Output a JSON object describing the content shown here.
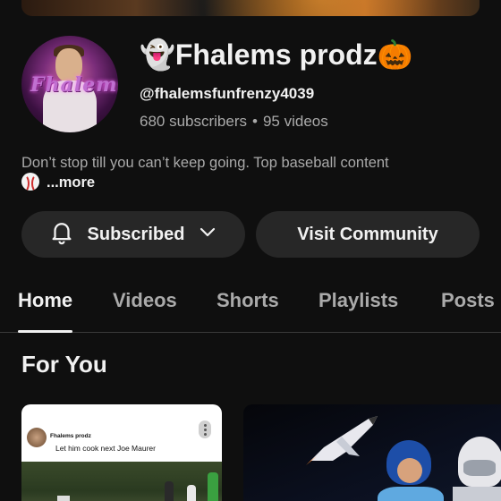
{
  "channel": {
    "name": "👻Fhalems prodz🎃",
    "handle": "@fhalemsfunfrenzy4039",
    "subscribers": "680 subscribers",
    "separator": "•",
    "videos": "95 videos",
    "avatar_text": "Fhalems",
    "description": "Don’t stop till you can’t keep going. Top baseball content",
    "more_label": "...more"
  },
  "actions": {
    "subscribed_label": "Subscribed",
    "community_label": "Visit Community"
  },
  "tabs": [
    {
      "label": "Home",
      "active": true
    },
    {
      "label": "Videos",
      "active": false
    },
    {
      "label": "Shorts",
      "active": false
    },
    {
      "label": "Playlists",
      "active": false
    },
    {
      "label": "Posts",
      "active": false
    }
  ],
  "sections": {
    "for_you_title": "For You"
  },
  "cards": [
    {
      "author": "Fhalems prodz",
      "caption": "Let him cook next Joe Maurer"
    },
    {}
  ],
  "icons": {
    "bell": "bell-icon",
    "chevron": "chevron-down-icon",
    "baseball": "baseball-icon",
    "kebab": "more-vert-icon"
  },
  "colors": {
    "background": "#0f0f0f",
    "button_bg": "#272727",
    "text_primary": "#f1f1f1",
    "text_secondary": "#aaaaaa"
  }
}
